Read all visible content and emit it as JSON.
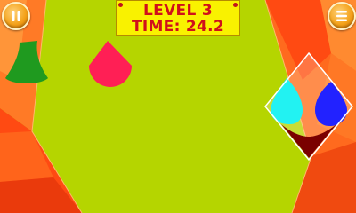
{
  "hud": {
    "level": "LEVEL 3",
    "time": "TIME: 24.2"
  },
  "icons": {
    "pause": "pause-icon",
    "menu": "menu-icon"
  },
  "colors": {
    "playfield": "#b5d500",
    "orange_border": "#ff5a1a",
    "hud_background": "#f9f200",
    "hud_text": "#d0101b",
    "green_piece": "#1f9a1f",
    "red_piece": "#ff1f55",
    "cyan_piece": "#22f2f2",
    "blue_piece": "#2222ff",
    "dark_red_piece": "#7a0000"
  }
}
